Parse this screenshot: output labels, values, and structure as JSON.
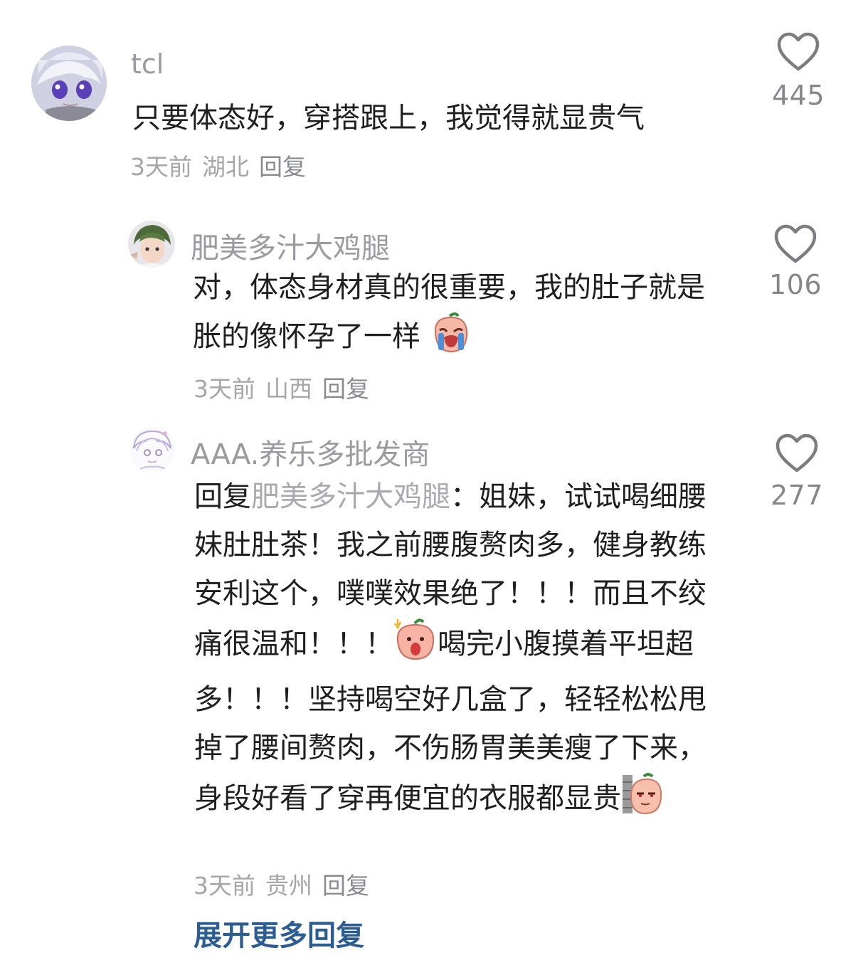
{
  "comments": [
    {
      "username": "tcl",
      "text": "只要体态好，穿搭跟上，我觉得就显贵气",
      "time": "3天前",
      "location": "湖北",
      "reply_label": "回复",
      "likes": "445",
      "avatar_icon": "anime-avatar-purple-eyes"
    },
    {
      "username": "肥美多汁大鸡腿",
      "text": "对，体态身材真的很重要，我的肚子就是胀的像怀孕了一样",
      "emoji": "crying-peach-emoji",
      "time": "3天前",
      "location": "山西",
      "reply_label": "回复",
      "likes": "106",
      "avatar_icon": "anime-avatar-green-hair"
    },
    {
      "username": "AAA.养乐多批发商",
      "reply_prefix": "回复",
      "mention": "肥美多汁大鸡腿",
      "text_part1": "：姐妹，试试喝细腰妹肚肚茶！我之前腰腹赘肉多，健身教练安利这个，噗噗效果绝了！！！而且不绞痛很温和！！！",
      "text_part2": "喝完小腹摸着平坦超多！！！坚持喝空好几盒了，轻轻松松甩掉了腰间赘肉，不伤肠胃美美瘦了下来，身段好看了穿再便宜的衣服都显贵",
      "emoji1": "shocked-peach-emoji",
      "emoji2": "peeking-peach-emoji",
      "time": "3天前",
      "location": "贵州",
      "reply_label": "回复",
      "likes": "277",
      "avatar_icon": "anime-avatar-sketch-purple"
    }
  ],
  "expand_more": "展开更多回复",
  "colors": {
    "accent_link": "#2b5d93",
    "meta_gray": "#a5a6aa",
    "username_gray": "#9a9ba0"
  }
}
